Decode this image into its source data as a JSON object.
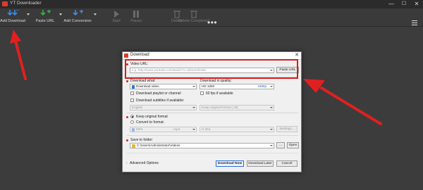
{
  "window": {
    "title": "YT Downloader",
    "min": "—",
    "max": "☐",
    "close": "✕"
  },
  "colors": {
    "accent_red": "#d81c1c",
    "toolbar_bg": "#3a3a3a",
    "primary_blue": "#2b6fd6"
  },
  "toolbar": {
    "add_download": "Add Download",
    "paste_url": "Paste URL",
    "add_conversion": "Add Conversion",
    "start": "Start",
    "pause": "Pause",
    "delete": "Delete",
    "delete_completed": "Delete Completed",
    "more": "•••"
  },
  "dialog": {
    "title": "Download",
    "close": "✕",
    "video_url_label": "Video URL:",
    "video_url_placeholder": "e.g. http://www.youtube.com/watch?v=Qbm2VEdo8",
    "paste_url_button": "Paste URL",
    "download_what_label": "Download what:",
    "download_what_value": "Download video",
    "quality_label": "Download in quality:",
    "quality_value": "HD 1080",
    "quality_accent": "1080p",
    "playlist_checkbox": "Download playlist or channel",
    "fps_checkbox": "60 fps if available",
    "subtitles_checkbox": "Download subtitles if available:",
    "subtitle_lang": "English",
    "subtitle_format": "Keep original format (.vtt)",
    "keep_format_radio": "Keep original format",
    "convert_radio": "Convert to format:",
    "format_value": "MP4",
    "format_ext": ".mp4",
    "codec_value": "H.264",
    "settings_button": "Settings...",
    "save_folder_label": "Save to folder:",
    "save_folder_value": "C:\\Users\\Administrator\\Videos",
    "browse_button": "...",
    "open_button": "Open",
    "advanced_options": "Advanced Options",
    "download_now": "Download Now",
    "download_later": "Download Later",
    "cancel": "Cancel"
  }
}
